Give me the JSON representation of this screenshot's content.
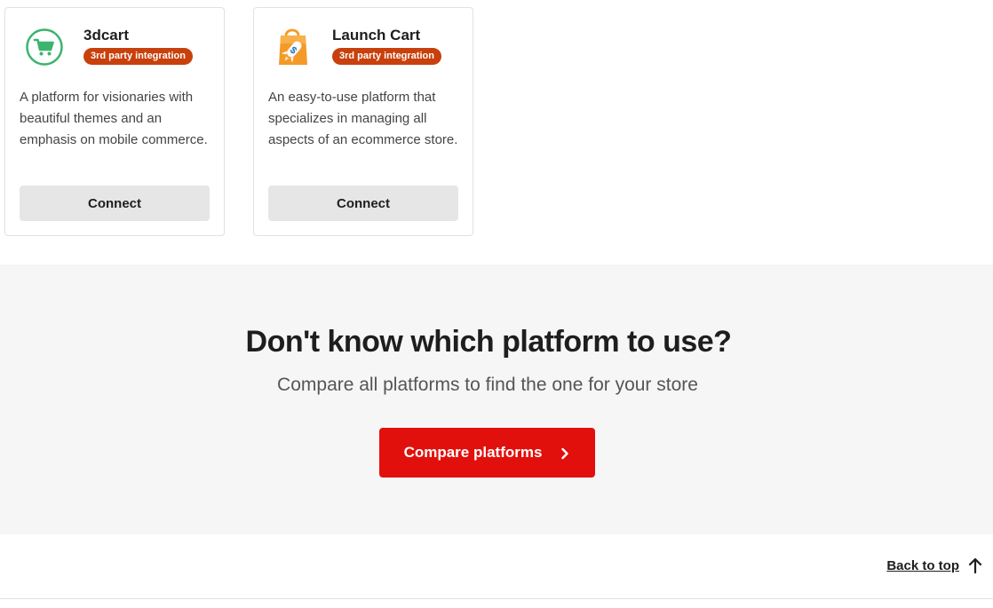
{
  "cards": [
    {
      "name": "3dcart",
      "badge": "3rd party integration",
      "description": "A platform for visionaries with beautiful themes and an emphasis on mobile commerce.",
      "button_label": "Connect",
      "logo_icon": "shopping-cart-icon",
      "logo_color": "#3cb46e"
    },
    {
      "name": "Launch Cart",
      "badge": "3rd party integration",
      "description": "An easy-to-use platform that specializes in managing all aspects of an ecommerce store.",
      "button_label": "Connect",
      "logo_icon": "shopping-bag-rocket-icon",
      "logo_color": "#f39a28"
    }
  ],
  "compare": {
    "title": "Don't know which platform to use?",
    "subtitle": "Compare all platforms to find the one for your store",
    "button_label": "Compare platforms"
  },
  "footer": {
    "back_to_top_label": "Back to top"
  },
  "colors": {
    "badge": "#c8400c",
    "primary_button": "#e2100c",
    "secondary_button": "#e6e6e6",
    "section_background": "#f6f6f6"
  }
}
